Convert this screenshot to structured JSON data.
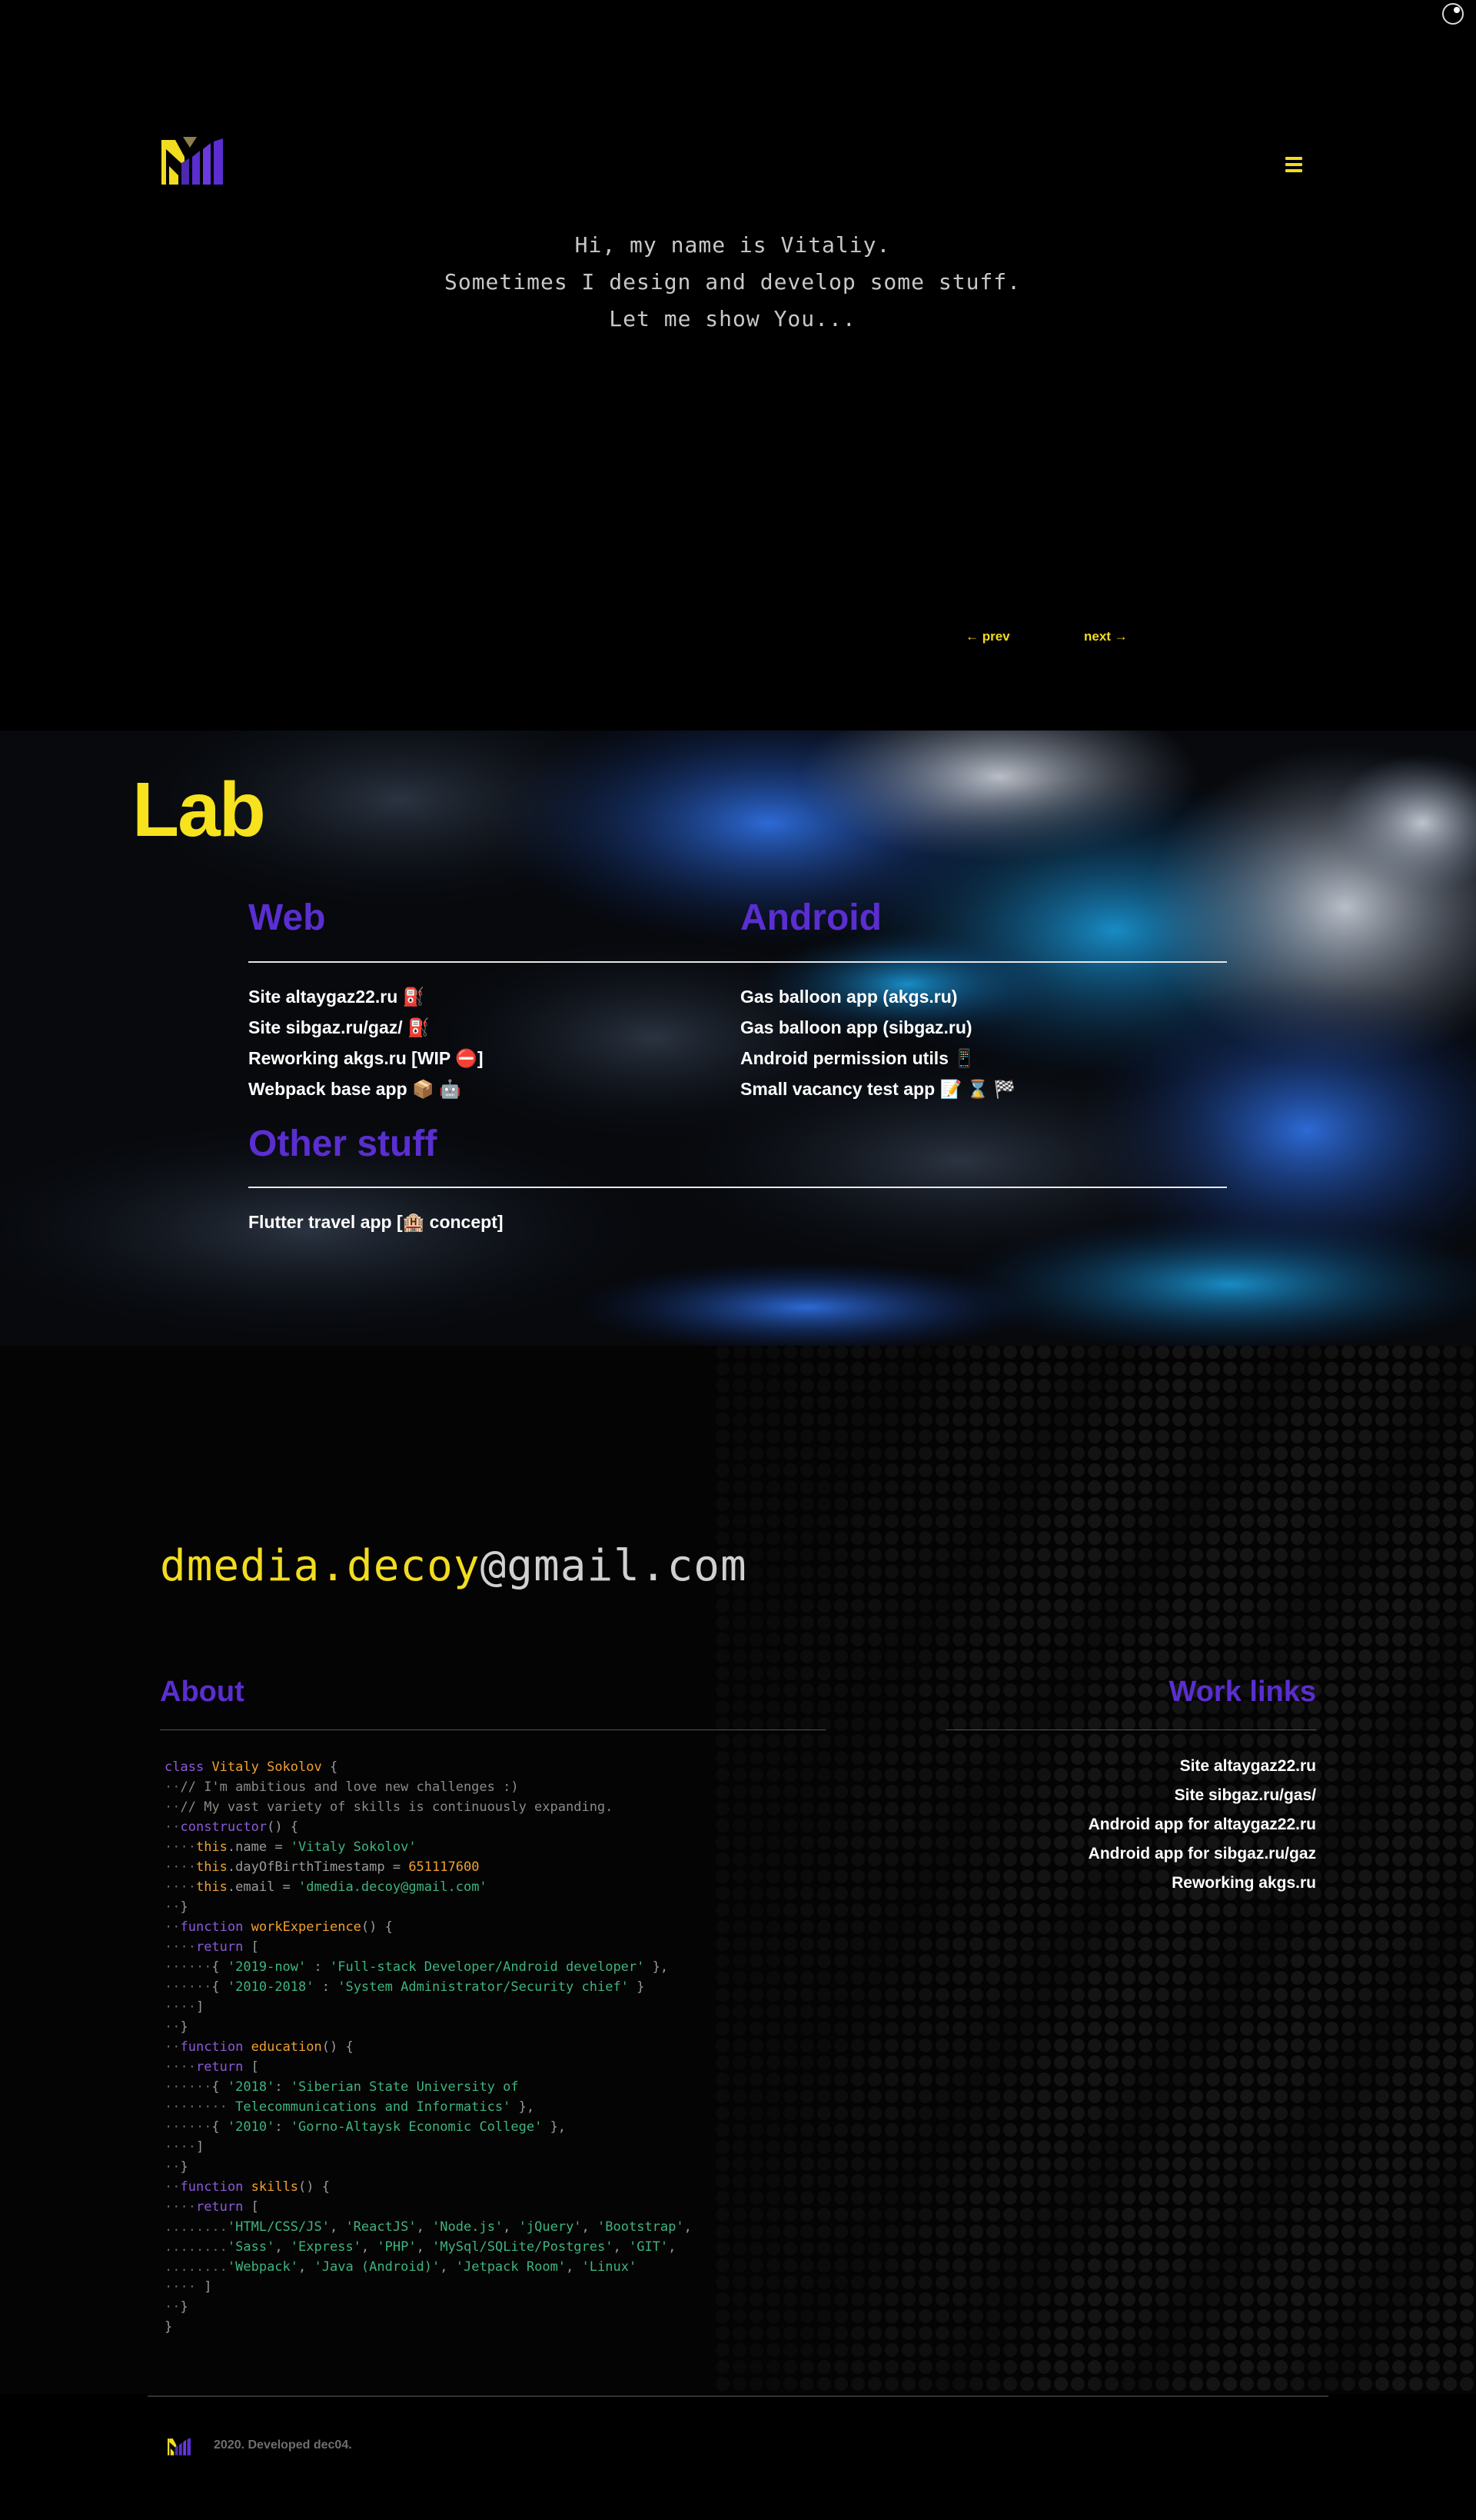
{
  "hero": {
    "intro_lines": [
      "Hi, my name is Vitaliy.",
      "Sometimes I design and develop some stuff.",
      "Let me show You..."
    ],
    "prev_label": "← prev",
    "next_label": "next →"
  },
  "lab": {
    "title": "Lab",
    "web": {
      "heading": "Web",
      "items": [
        "Site altaygaz22.ru ⛽",
        "Site sibgaz.ru/gaz/ ⛽",
        "Reworking akgs.ru [WIP ⛔]",
        "Webpack base app 📦 🤖"
      ]
    },
    "android": {
      "heading": "Android",
      "items": [
        "Gas balloon app (akgs.ru)",
        "Gas balloon app (sibgaz.ru)",
        "Android permission utils 📱",
        "Small vacancy test app 📝 ⌛ 🏁"
      ]
    },
    "other": {
      "heading": "Other stuff",
      "items": [
        "Flutter travel app [🏨 concept]"
      ]
    }
  },
  "contact": {
    "email_user": "dmedia.decoy",
    "email_domain": "@gmail.com"
  },
  "about": {
    "heading": "About"
  },
  "work_links": {
    "heading": "Work links",
    "items": [
      "Site altaygaz22.ru",
      "Site sibgaz.ru/gas/",
      "Android app for altaygaz22.ru",
      "Android app for sibgaz.ru/gaz",
      "Reworking akgs.ru"
    ]
  },
  "footer": {
    "text": "2020. Developed dec04."
  },
  "colors": {
    "accent_yellow": "#f1dc20",
    "accent_purple": "#5a2ed0",
    "code_string": "#3fb37f",
    "code_keyword": "#8b5ad8"
  }
}
